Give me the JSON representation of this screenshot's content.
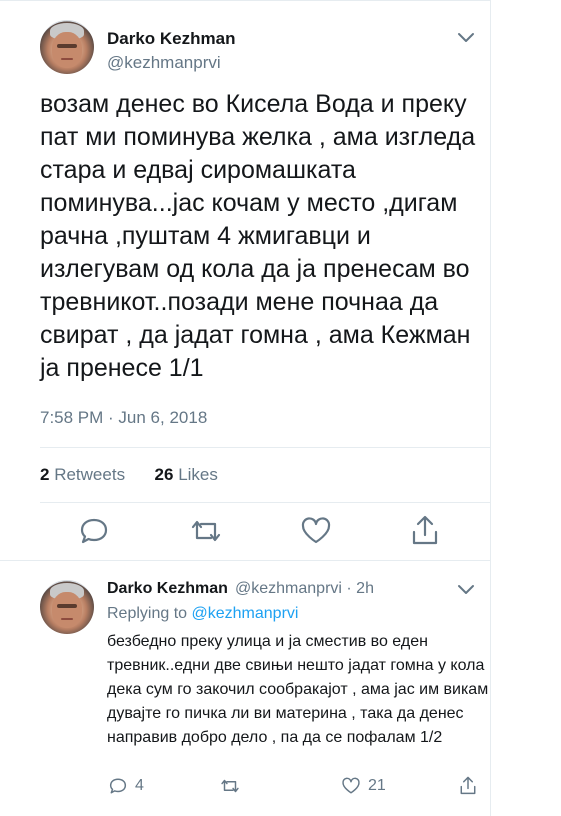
{
  "main_tweet": {
    "author_name": "Darko Kezhman",
    "author_handle": "@kezhmanprvi",
    "text": "возам денес во Кисела Вода и преку пат ми поминува желка , ама изгледа стара и едвај сиромашката поминува...јас кочам у место ,дигам рачна ,пуштам 4 жмигавци и излегувам од кола да ја пренесам во тревникот..позади мене почнаа да свират , да јадат гомна , ама Кежман ја пренесе 1/1",
    "timestamp": "7:58 PM · Jun 6, 2018",
    "retweets_count": "2",
    "retweets_label": "Retweets",
    "likes_count": "26",
    "likes_label": "Likes",
    "icons": [
      "comment-icon",
      "retweet-icon",
      "like-icon",
      "share-icon",
      "chevron-down-icon"
    ]
  },
  "reply_tweet": {
    "author_name": "Darko Kezhman",
    "author_handle_time": "@kezhmanprvi · 2h",
    "replying_prefix": "Replying to",
    "replying_handle": "@kezhmanprvi",
    "text": "безбедно преку улица и ја сместив во еден тревник..едни две свињи нешто јадат гомна у кола дека сум го закочил сообракајот , ама јас им викам дувајте го пичка ли ви материна , така да денес направив добро дело , па да се пофалам 1/2",
    "reply_count": "4",
    "like_count": "21"
  },
  "colors": {
    "text_primary": "#14171a",
    "text_secondary": "#657786",
    "link": "#1da1f2",
    "divider": "#e6ecf0"
  }
}
